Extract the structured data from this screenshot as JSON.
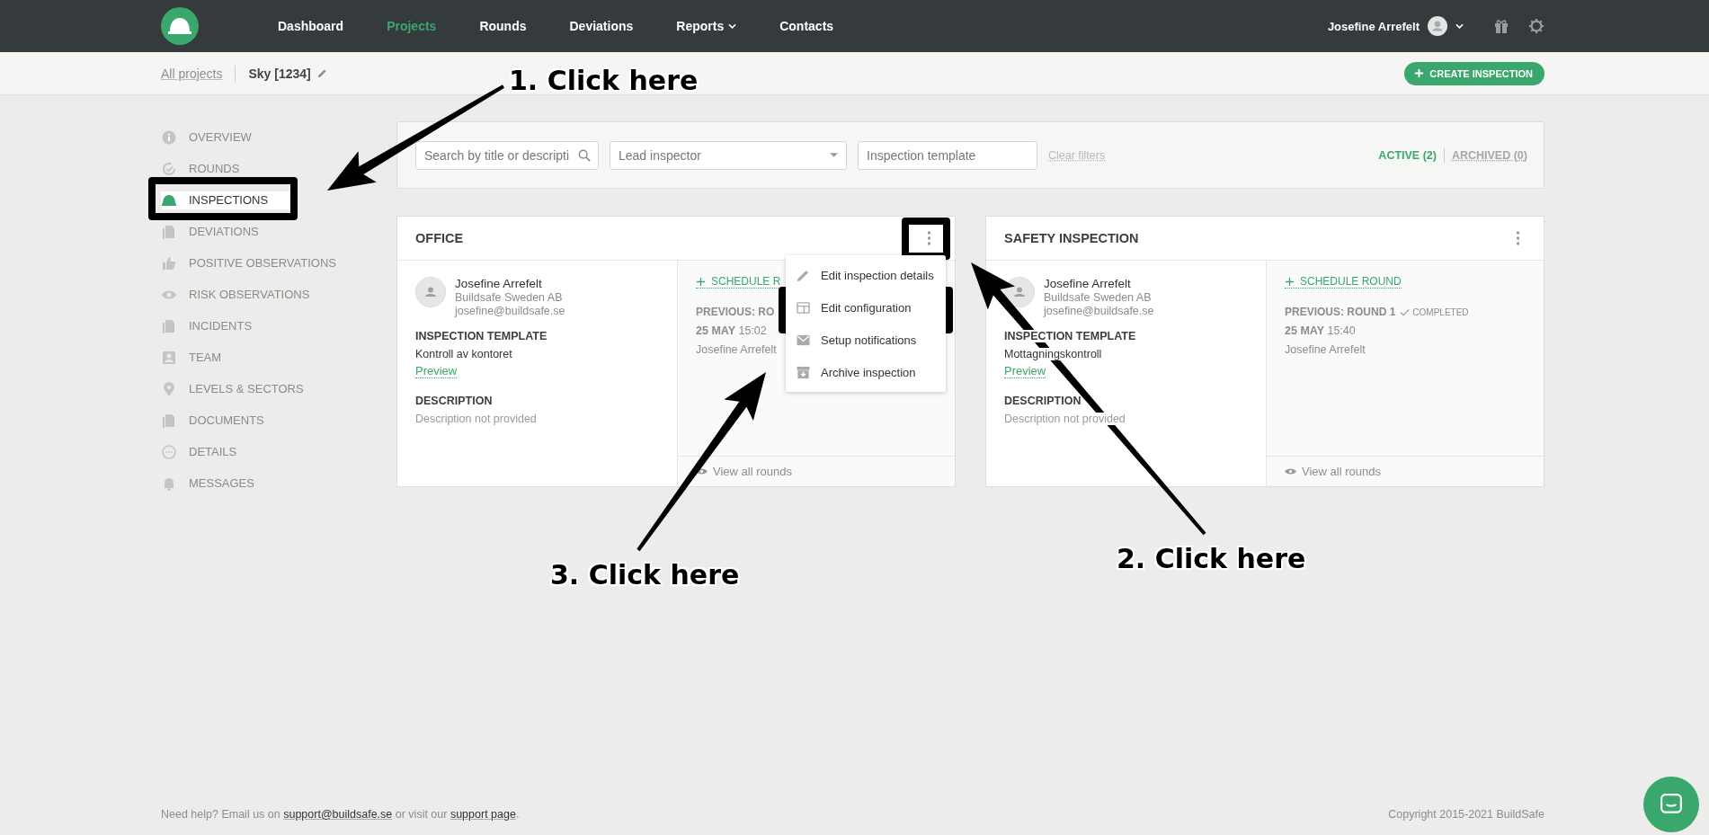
{
  "nav": {
    "items": [
      {
        "label": "Dashboard",
        "selected": false,
        "dropdown": false
      },
      {
        "label": "Projects",
        "selected": true,
        "dropdown": false
      },
      {
        "label": "Rounds",
        "selected": false,
        "dropdown": false
      },
      {
        "label": "Deviations",
        "selected": false,
        "dropdown": false
      },
      {
        "label": "Reports",
        "selected": false,
        "dropdown": true
      },
      {
        "label": "Contacts",
        "selected": false,
        "dropdown": false
      }
    ],
    "user": "Josefine Arrefelt"
  },
  "breadcrumb": {
    "parent": "All projects",
    "current": "Sky [1234]"
  },
  "create_button": "CREATE INSPECTION",
  "sidebar": {
    "items": [
      {
        "label": "OVERVIEW",
        "selected": false
      },
      {
        "label": "ROUNDS",
        "selected": false
      },
      {
        "label": "INSPECTIONS",
        "selected": true
      },
      {
        "label": "DEVIATIONS",
        "selected": false
      },
      {
        "label": "POSITIVE OBSERVATIONS",
        "selected": false
      },
      {
        "label": "RISK OBSERVATIONS",
        "selected": false
      },
      {
        "label": "INCIDENTS",
        "selected": false
      },
      {
        "label": "TEAM",
        "selected": false
      },
      {
        "label": "LEVELS & SECTORS",
        "selected": false
      },
      {
        "label": "DOCUMENTS",
        "selected": false
      },
      {
        "label": "DETAILS",
        "selected": false
      },
      {
        "label": "MESSAGES",
        "selected": false
      }
    ]
  },
  "filters": {
    "search": {
      "placeholder": "Search by title or descripti"
    },
    "lead_inspector": {
      "placeholder": "Lead inspector"
    },
    "template": {
      "placeholder": "Inspection template"
    },
    "clear": "Clear filters",
    "tabs": [
      {
        "label": "ACTIVE (2)",
        "selected": true
      },
      {
        "label": "ARCHIVED (0)",
        "selected": false
      }
    ]
  },
  "cards": [
    {
      "title": "OFFICE",
      "inspector": {
        "name": "Josefine Arrefelt",
        "company": "Buildsafe Sweden AB",
        "email": "josefine@buildsafe.se"
      },
      "template_heading": "INSPECTION TEMPLATE",
      "template": "Kontroll av kontoret",
      "preview": "Preview",
      "description_heading": "DESCRIPTION",
      "description": "Description not provided",
      "schedule": "SCHEDULE R",
      "previous": "PREVIOUS: RO",
      "date": "**25 MAY** 15:02",
      "round_by": "Josefine Arrefelt",
      "view_all": "View all rounds",
      "menu": {
        "items": [
          "Edit inspection details",
          "Edit configuration",
          "Setup notifications",
          "Archive inspection"
        ]
      }
    },
    {
      "title": "SAFETY INSPECTION",
      "inspector": {
        "name": "Josefine Arrefelt",
        "company": "Buildsafe Sweden AB",
        "email": "josefine@buildsafe.se"
      },
      "template_heading": "INSPECTION TEMPLATE",
      "template": "Mottagningskontroll",
      "preview": "Preview",
      "description_heading": "DESCRIPTION",
      "description": "Description not provided",
      "schedule": "SCHEDULE ROUND",
      "previous": "PREVIOUS: ROUND 1",
      "status": "COMPLETED",
      "date": "**25 MAY** 15:40",
      "round_by": "Josefine Arrefelt",
      "view_all": "View all rounds"
    }
  ],
  "footer": {
    "before": "Need help? Email us on",
    "email": "support@buildsafe.se",
    "middle": "or visit our",
    "link": "support page",
    "after": ".",
    "copyright": "Copyright 2015-2021 BuildSafe"
  },
  "callouts": [
    "1. Click here",
    "2. Click here",
    "3. Click here"
  ]
}
